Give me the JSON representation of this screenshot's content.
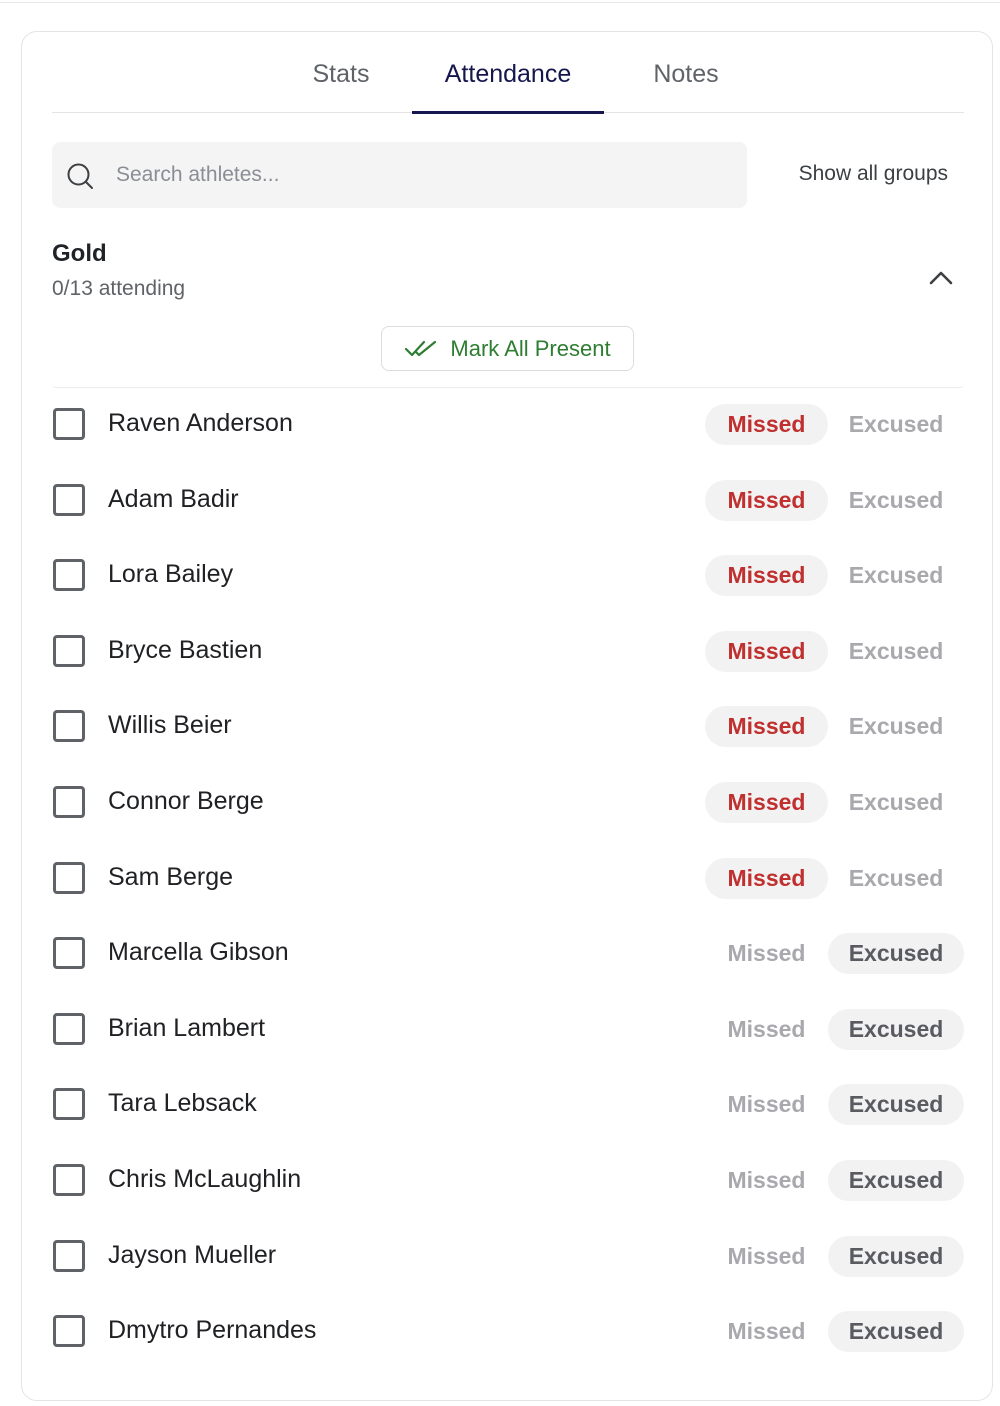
{
  "tabs": [
    {
      "label": "Stats",
      "active": false
    },
    {
      "label": "Attendance",
      "active": true
    },
    {
      "label": "Notes",
      "active": false
    }
  ],
  "search": {
    "placeholder": "Search athletes...",
    "value": "",
    "icon": "search-icon"
  },
  "show_groups_label": "Show all groups",
  "group": {
    "title": "Gold",
    "attending": "0/13 attending",
    "collapse_icon": "chevron-up-icon",
    "mark_all_label": "Mark All Present",
    "mark_all_icon": "double-check-icon"
  },
  "status_labels": {
    "missed": "Missed",
    "excused": "Excused"
  },
  "colors": {
    "accent": "#14164d",
    "missed": "#c0302f",
    "present": "#2e7d32"
  },
  "athletes": [
    {
      "name": "Raven Anderson",
      "status": "missed",
      "checked": false
    },
    {
      "name": "Adam Badir",
      "status": "missed",
      "checked": false
    },
    {
      "name": "Lora Bailey",
      "status": "missed",
      "checked": false
    },
    {
      "name": "Bryce Bastien",
      "status": "missed",
      "checked": false
    },
    {
      "name": "Willis Beier",
      "status": "missed",
      "checked": false
    },
    {
      "name": "Connor Berge",
      "status": "missed",
      "checked": false
    },
    {
      "name": "Sam Berge",
      "status": "missed",
      "checked": false
    },
    {
      "name": "Marcella Gibson",
      "status": "excused",
      "checked": false
    },
    {
      "name": "Brian Lambert",
      "status": "excused",
      "checked": false
    },
    {
      "name": "Tara Lebsack",
      "status": "excused",
      "checked": false
    },
    {
      "name": "Chris McLaughlin",
      "status": "excused",
      "checked": false
    },
    {
      "name": "Jayson Mueller",
      "status": "excused",
      "checked": false
    },
    {
      "name": "Dmytro Pernandes",
      "status": "excused",
      "checked": false
    }
  ]
}
